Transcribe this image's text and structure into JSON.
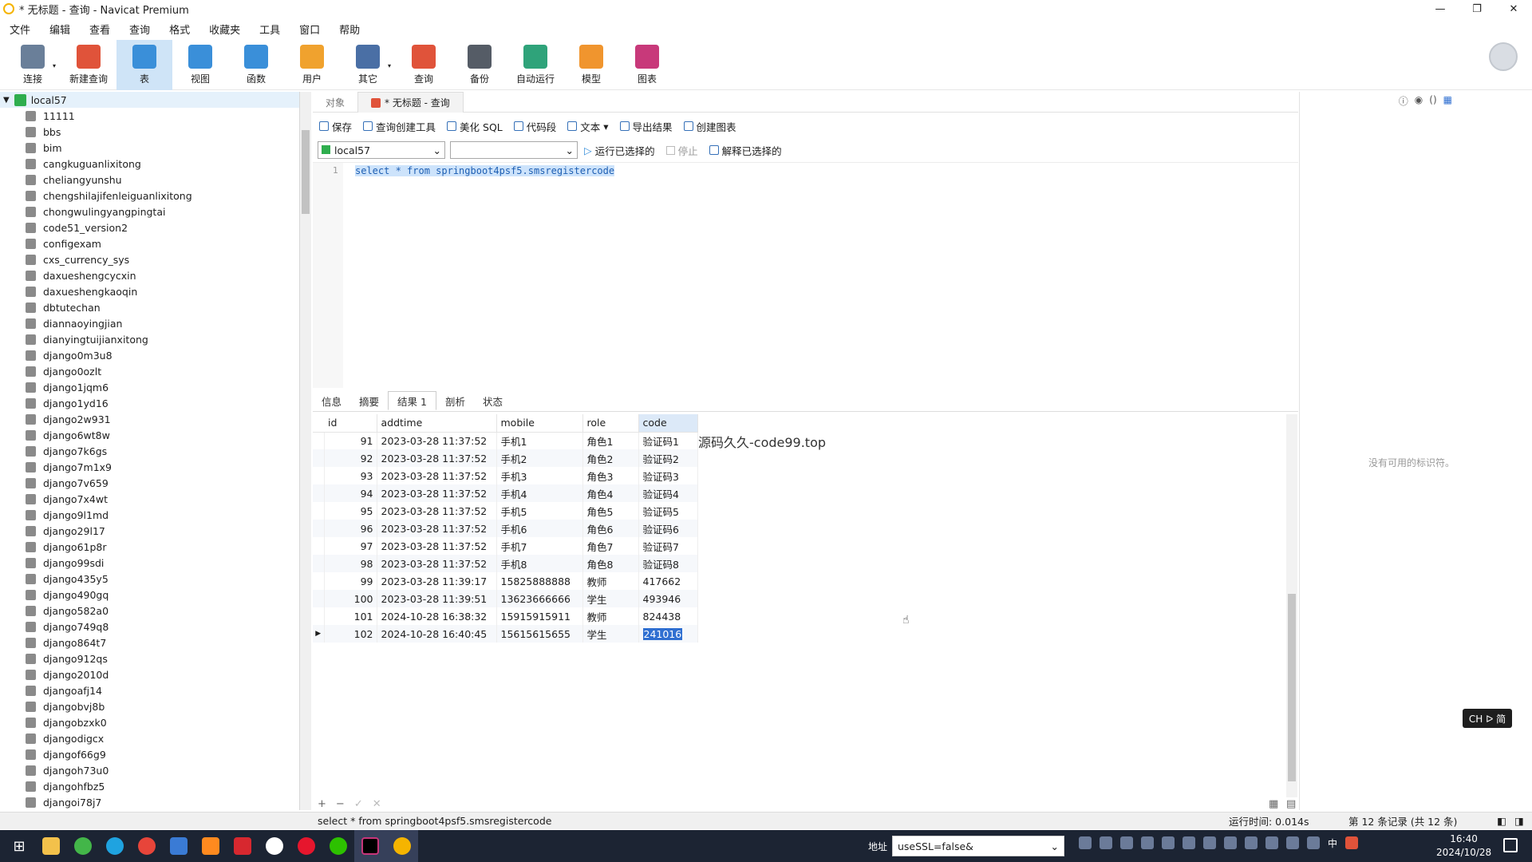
{
  "window": {
    "title": "* 无标题 - 查询 - Navicat Premium",
    "minimize": "—",
    "restore": "❐",
    "close": "✕"
  },
  "menu": [
    "文件",
    "编辑",
    "查看",
    "查询",
    "格式",
    "收藏夹",
    "工具",
    "窗口",
    "帮助"
  ],
  "toolbar": [
    {
      "label": "连接",
      "icon": "plug-icon",
      "color": "#6a7f99"
    },
    {
      "label": "新建查询",
      "icon": "new-query-icon",
      "color": "#e0533a"
    },
    {
      "label": "表",
      "icon": "table-icon",
      "color": "#3a8fd9"
    },
    {
      "label": "视图",
      "icon": "view-icon",
      "color": "#3a8fd9"
    },
    {
      "label": "函数",
      "icon": "function-icon",
      "color": "#3a8fd9"
    },
    {
      "label": "用户",
      "icon": "user-icon",
      "color": "#f0a22e"
    },
    {
      "label": "其它",
      "icon": "tools-icon",
      "color": "#4a6fa5"
    },
    {
      "label": "查询",
      "icon": "query-icon",
      "color": "#e0533a"
    },
    {
      "label": "备份",
      "icon": "backup-icon",
      "color": "#555c66"
    },
    {
      "label": "自动运行",
      "icon": "robot-icon",
      "color": "#2fa37a"
    },
    {
      "label": "模型",
      "icon": "model-icon",
      "color": "#f0952e"
    },
    {
      "label": "图表",
      "icon": "chart-icon",
      "color": "#c8397a"
    }
  ],
  "sidebar": {
    "root": "local57",
    "databases": [
      "11111",
      "bbs",
      "bim",
      "cangkuguanlixitong",
      "cheliangyunshu",
      "chengshilajifenleiguanlixitong",
      "chongwulingyangpingtai",
      "code51_version2",
      "configexam",
      "cxs_currency_sys",
      "daxueshengcycxin",
      "daxueshengkaoqin",
      "dbtutechan",
      "diannaoyingjian",
      "dianyingtuijianxitong",
      "django0m3u8",
      "django0ozlt",
      "django1jqm6",
      "django1yd16",
      "django2w931",
      "django6wt8w",
      "django7k6gs",
      "django7m1x9",
      "django7v659",
      "django7x4wt",
      "django9l1md",
      "django29l17",
      "django61p8r",
      "django99sdi",
      "django435y5",
      "django490gq",
      "django582a0",
      "django749q8",
      "django864t7",
      "django912qs",
      "django2010d",
      "djangoafj14",
      "djangobvj8b",
      "djangobzxk0",
      "djangodigcx",
      "djangof66g9",
      "djangoh73u0",
      "djangohfbz5",
      "djangoi78j7"
    ]
  },
  "tabs": {
    "objects": "对象",
    "query": "* 无标题 - 查询"
  },
  "querybar": {
    "save": "保存",
    "builder": "查询创建工具",
    "beautify": "美化 SQL",
    "snippet": "代码段",
    "text": "文本",
    "export": "导出结果",
    "chart": "创建图表"
  },
  "runbar": {
    "connection": "local57",
    "database": "",
    "run": "运行已选择的",
    "stop": "停止",
    "explain": "解释已选择的"
  },
  "editor": {
    "line": "1",
    "sql": "select * from springboot4psf5.smsregistercode"
  },
  "result_tabs": [
    "信息",
    "摘要",
    "结果 1",
    "剖析",
    "状态"
  ],
  "grid": {
    "columns": [
      "id",
      "addtime",
      "mobile",
      "role",
      "code"
    ],
    "rows": [
      [
        "91",
        "2023-03-28 11:37:52",
        "手机1",
        "角色1",
        "验证码1"
      ],
      [
        "92",
        "2023-03-28 11:37:52",
        "手机2",
        "角色2",
        "验证码2"
      ],
      [
        "93",
        "2023-03-28 11:37:52",
        "手机3",
        "角色3",
        "验证码3"
      ],
      [
        "94",
        "2023-03-28 11:37:52",
        "手机4",
        "角色4",
        "验证码4"
      ],
      [
        "95",
        "2023-03-28 11:37:52",
        "手机5",
        "角色5",
        "验证码5"
      ],
      [
        "96",
        "2023-03-28 11:37:52",
        "手机6",
        "角色6",
        "验证码6"
      ],
      [
        "97",
        "2023-03-28 11:37:52",
        "手机7",
        "角色7",
        "验证码7"
      ],
      [
        "98",
        "2023-03-28 11:37:52",
        "手机8",
        "角色8",
        "验证码8"
      ],
      [
        "99",
        "2023-03-28 11:39:17",
        "15825888888",
        "教师",
        "417662"
      ],
      [
        "100",
        "2023-03-28 11:39:51",
        "13623666666",
        "学生",
        "493946"
      ],
      [
        "101",
        "2024-10-28 16:38:32",
        "15915915911",
        "教师",
        "824438"
      ],
      [
        "102",
        "2024-10-28 16:40:45",
        "15615615655",
        "学生",
        "241016"
      ]
    ]
  },
  "watermark": "源码久久-code99.top",
  "rightpanel": {
    "empty": "没有可用的标识符。"
  },
  "ime_badge": "CH ᐅ 简",
  "status": {
    "sql": "select * from springboot4psf5.smsregistercode",
    "time": "运行时间: 0.014s",
    "records": "第 12 条记录 (共 12 条)"
  },
  "taskbar": {
    "address_label": "地址",
    "address_value": "useSSL=false&",
    "ime": "中",
    "time": "16:40",
    "date": "2024/10/28"
  }
}
